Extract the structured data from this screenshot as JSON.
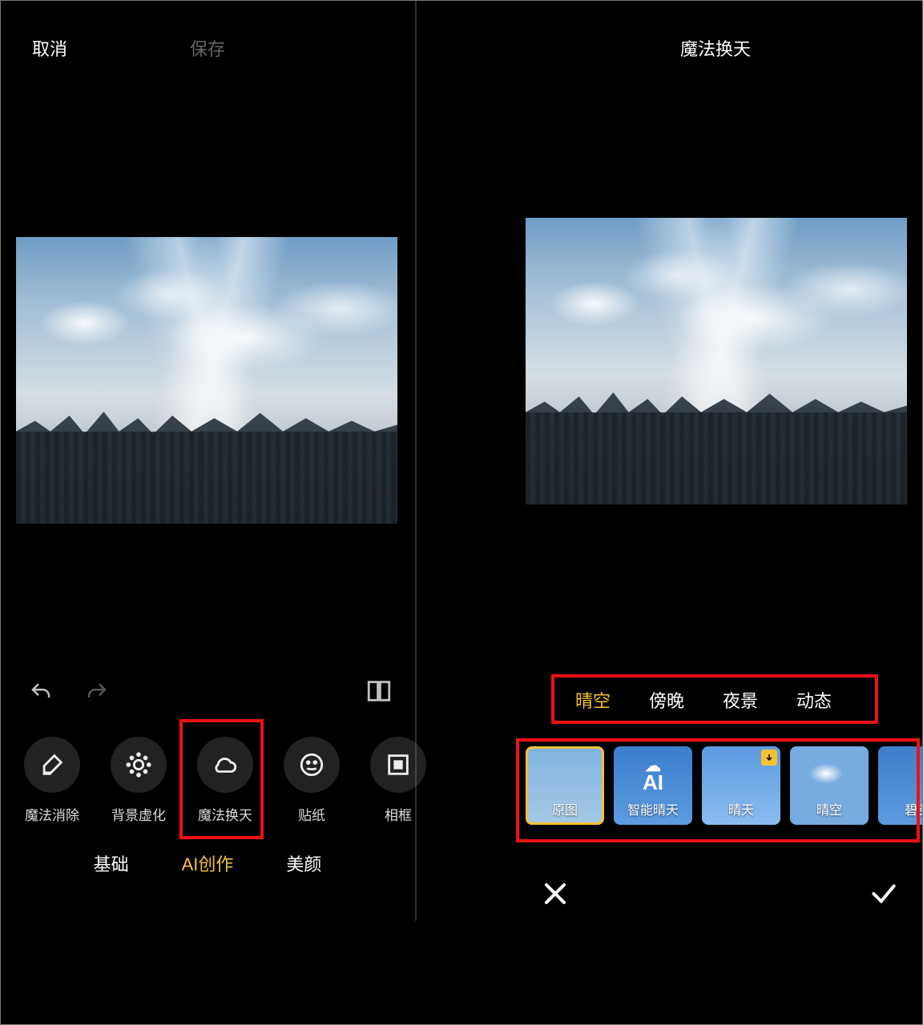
{
  "left": {
    "header": {
      "cancel": "取消",
      "save": "保存"
    },
    "tools": [
      {
        "id": "magic-erase",
        "label": "魔法消除"
      },
      {
        "id": "bg-blur",
        "label": "背景虚化"
      },
      {
        "id": "magic-sky",
        "label": "魔法换天"
      },
      {
        "id": "sticker",
        "label": "贴纸"
      },
      {
        "id": "frame",
        "label": "相框"
      }
    ],
    "tabs": [
      {
        "id": "basic",
        "label": "基础"
      },
      {
        "id": "ai",
        "label": "AI创作",
        "active": true
      },
      {
        "id": "beauty",
        "label": "美颜"
      }
    ]
  },
  "right": {
    "header": {
      "title": "魔法换天"
    },
    "categories": [
      {
        "id": "clear",
        "label": "晴空",
        "active": true
      },
      {
        "id": "evening",
        "label": "傍晚"
      },
      {
        "id": "night",
        "label": "夜景"
      },
      {
        "id": "dynamic",
        "label": "动态"
      }
    ],
    "presets": [
      {
        "id": "orig",
        "label": "原图",
        "selected": true
      },
      {
        "id": "ai-sun",
        "label": "智能晴天"
      },
      {
        "id": "sunny",
        "label": "晴天",
        "download": true
      },
      {
        "id": "sky",
        "label": "晴空"
      },
      {
        "id": "azure",
        "label": "碧空"
      }
    ]
  }
}
